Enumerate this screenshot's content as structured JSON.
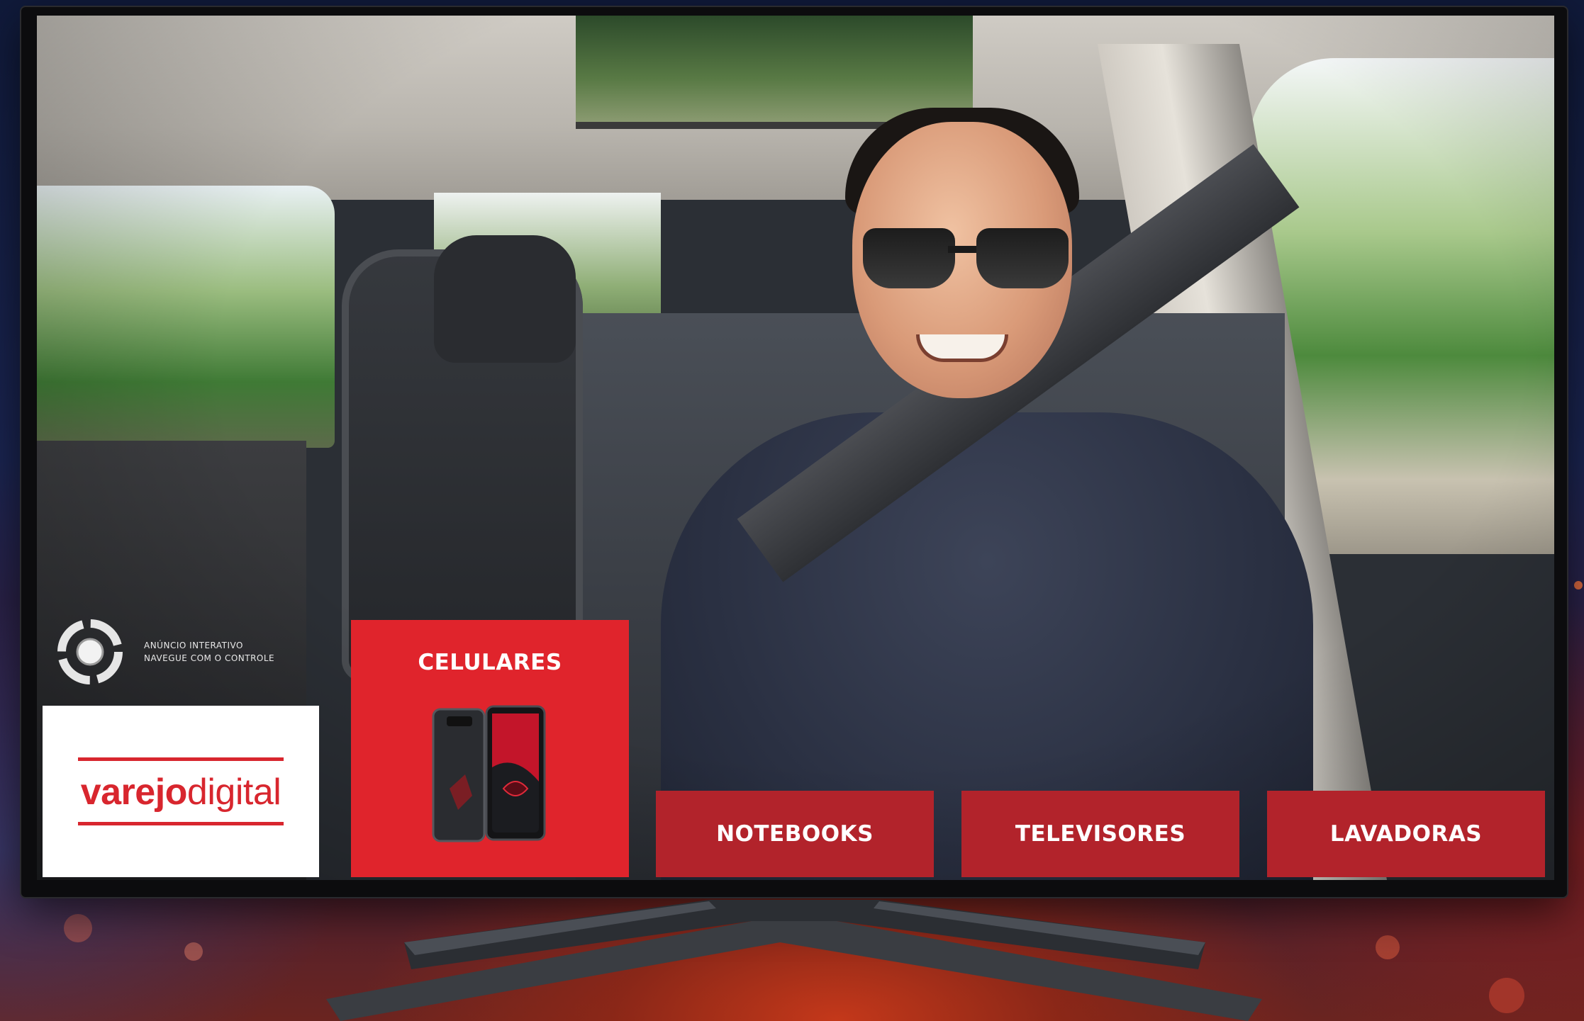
{
  "overlay": {
    "hint_line1": "ANÚNCIO INTERATIVO",
    "hint_line2": "NAVEGUE COM O CONTROLE"
  },
  "brand": {
    "name_bold": "varejo",
    "name_regular": "digital",
    "color": "#d8262e"
  },
  "categories": {
    "active": {
      "label": "CELULARES",
      "color": "#e0242c"
    },
    "items": [
      {
        "label": "NOTEBOOKS"
      },
      {
        "label": "TELEVISORES"
      },
      {
        "label": "LAVADORAS"
      }
    ],
    "button_color": "#b2232b"
  },
  "icons": {
    "interactive": "target-ring-icon",
    "product": "smartphone-icon"
  }
}
